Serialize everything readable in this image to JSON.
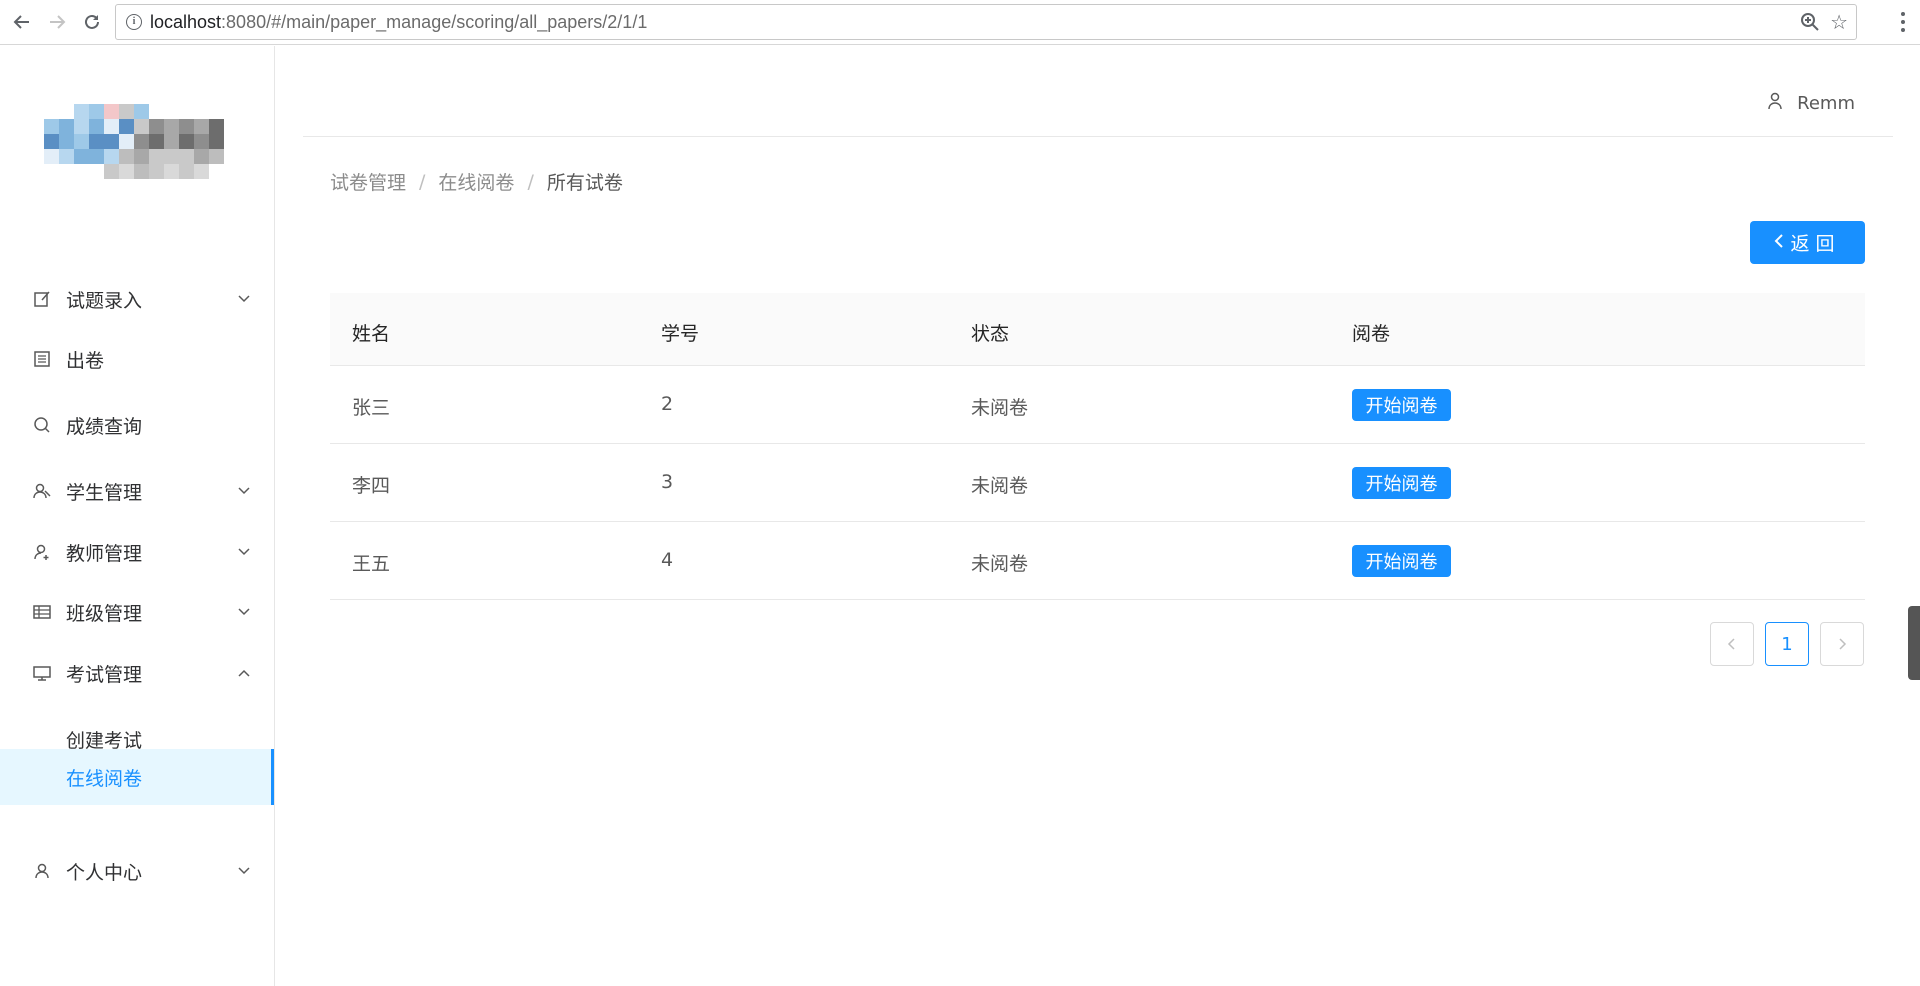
{
  "browser": {
    "url_host": "localhost",
    "url_path": ":8080/#/main/paper_manage/scoring/all_papers/2/1/1"
  },
  "sidebar": {
    "items": [
      {
        "label": "试题录入",
        "icon": "edit-icon",
        "expandable": true
      },
      {
        "label": "出卷",
        "icon": "file-text-icon",
        "expandable": false
      },
      {
        "label": "成绩查询",
        "icon": "search-icon",
        "expandable": false
      },
      {
        "label": "学生管理",
        "icon": "user-group-icon",
        "expandable": true
      },
      {
        "label": "教师管理",
        "icon": "user-add-icon",
        "expandable": true
      },
      {
        "label": "班级管理",
        "icon": "table-icon",
        "expandable": true
      },
      {
        "label": "考试管理",
        "icon": "desktop-icon",
        "expandable": true,
        "expanded": true
      },
      {
        "label": "个人中心",
        "icon": "user-icon",
        "expandable": true
      }
    ],
    "subitems": [
      {
        "label": "创建考试",
        "active": false
      },
      {
        "label": "在线阅卷",
        "active": true
      }
    ]
  },
  "header": {
    "username": "Remm"
  },
  "breadcrumb": [
    "试卷管理",
    "在线阅卷",
    "所有试卷"
  ],
  "back_button": "返回",
  "table": {
    "columns": [
      "姓名",
      "学号",
      "状态",
      "阅卷"
    ],
    "rows": [
      {
        "name": "张三",
        "id": "2",
        "status": "未阅卷",
        "action": "开始阅卷"
      },
      {
        "name": "李四",
        "id": "3",
        "status": "未阅卷",
        "action": "开始阅卷"
      },
      {
        "name": "王五",
        "id": "4",
        "status": "未阅卷",
        "action": "开始阅卷"
      }
    ]
  },
  "pagination": {
    "current": "1"
  },
  "colors": {
    "primary": "#1890ff",
    "active_bg": "#e6f7ff"
  }
}
